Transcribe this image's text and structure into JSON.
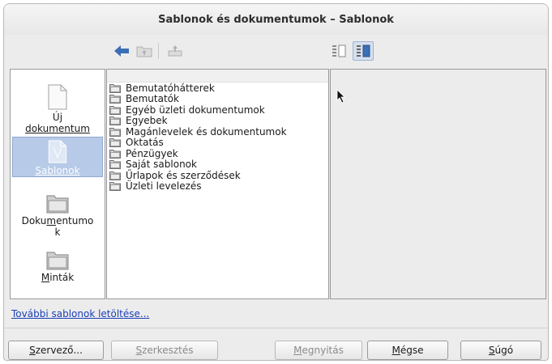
{
  "window": {
    "title": "Sablonok és dokumentumok – Sablonok"
  },
  "toolbar": {
    "back_icon": "back-arrow-icon",
    "up_icon": "folder-up-icon",
    "print_icon": "print-icon",
    "view_list_icon": "list-view-icon",
    "view_detail_icon": "detail-view-icon"
  },
  "sidebar": {
    "items": [
      {
        "label_pre": "Új",
        "label_line2": "dokumentum",
        "icon": "new-document-icon",
        "selected": false
      },
      {
        "label": "Sablonok",
        "icon": "template-icon",
        "selected": true
      },
      {
        "label_pre": "Doku",
        "label_u": "m",
        "label_post": "entumo",
        "label_line2": "k",
        "icon": "documents-folder-icon",
        "selected": false
      },
      {
        "label_u": "M",
        "label_post": "inták",
        "icon": "samples-folder-icon",
        "selected": false
      }
    ]
  },
  "list": {
    "items": [
      "Bemutatóhátterek",
      "Bemutatók",
      "Egyéb üzleti dokumentumok",
      "Egyebek",
      "Magánlevelek és dokumentumok",
      "Oktatás",
      "Pénzügyek",
      "Saját sablonok",
      "Űrlapok és szerződések",
      "Üzleti levelezés"
    ]
  },
  "link": {
    "more_templates": "További sablonok letöltése..."
  },
  "buttons": {
    "organize": {
      "u": "S",
      "rest": "zervező...",
      "enabled": true
    },
    "edit": {
      "u": "S",
      "rest": "zerkesztés",
      "enabled": false
    },
    "open": {
      "u": "M",
      "rest": "egnyitás",
      "enabled": false
    },
    "cancel": {
      "u": "M",
      "rest": "égse",
      "enabled": true
    },
    "help": {
      "u": "S",
      "rest": "úgó",
      "enabled": true
    }
  },
  "colors": {
    "selection": "#b7cbe8",
    "link": "#1a3fb8",
    "back_arrow": "#3b6fb6"
  }
}
